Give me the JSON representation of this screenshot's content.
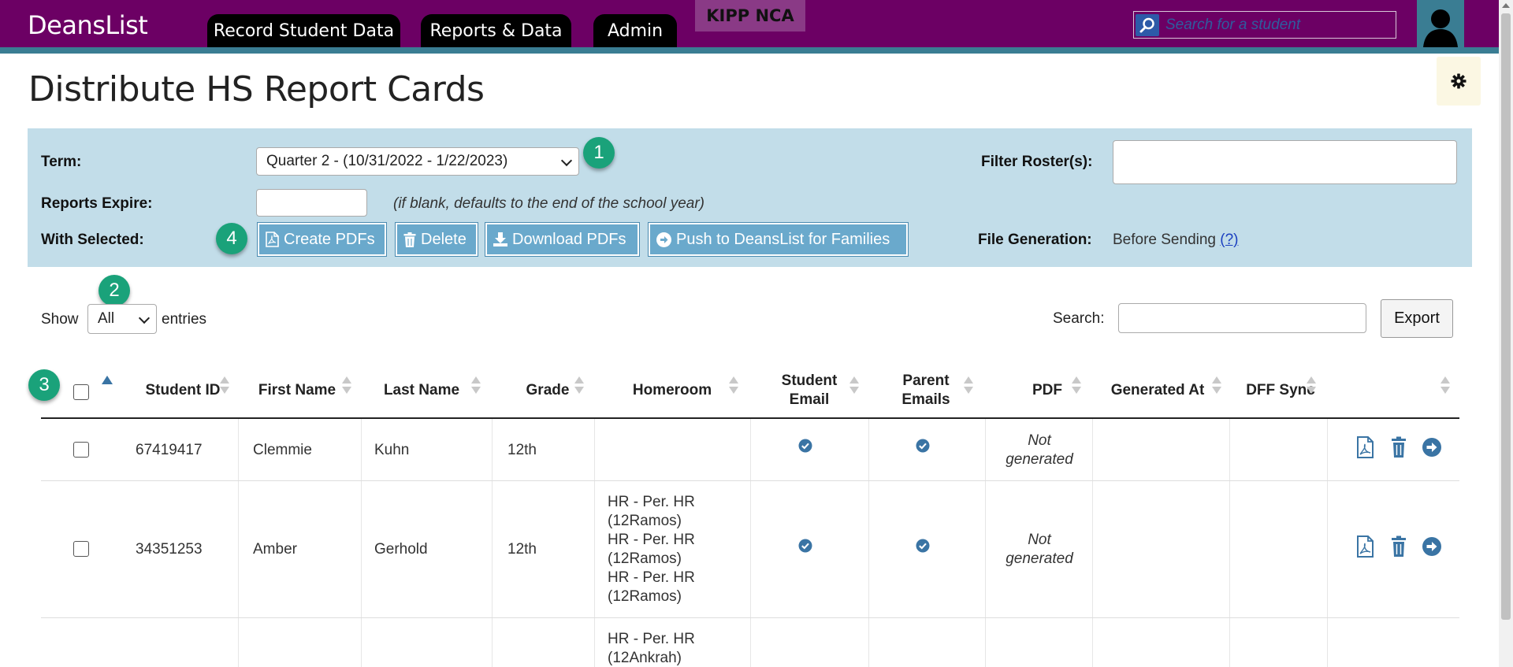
{
  "topbar": {
    "brand": "DeansList",
    "tabs": [
      "Record Student Data",
      "Reports & Data",
      "Admin"
    ],
    "school": "KIPP NCA",
    "search_placeholder": "Search for a student"
  },
  "page": {
    "title": "Distribute HS Report Cards"
  },
  "filters": {
    "term_label": "Term:",
    "term_value": "Quarter 2 - (10/31/2022 - 1/22/2023)",
    "expire_label": "Reports Expire:",
    "expire_hint": "(if blank, defaults to the end of the school year)",
    "with_selected_label": "With Selected:",
    "actions": [
      "Create PDFs",
      "Delete",
      "Download PDFs",
      "Push to DeansList for Families"
    ],
    "filter_roster_label": "Filter Roster(s):",
    "file_generation_label": "File Generation:",
    "file_generation_value": "Before Sending",
    "file_generation_help": "(?)"
  },
  "steps": [
    "1",
    "2",
    "3",
    "4"
  ],
  "entries": {
    "show_label": "Show",
    "value": "All",
    "entries_label": "entries",
    "search_label": "Search:",
    "export_label": "Export"
  },
  "table": {
    "headers": [
      "Student ID",
      "First Name",
      "Last Name",
      "Grade",
      "Homeroom",
      "Student Email",
      "Parent Emails",
      "PDF",
      "Generated At",
      "DFF Sync"
    ],
    "rows": [
      {
        "student_id": "67419417",
        "first_name": "Clemmie",
        "last_name": "Kuhn",
        "grade": "12th",
        "homeroom": [],
        "pdf": "Not generated"
      },
      {
        "student_id": "34351253",
        "first_name": "Amber",
        "last_name": "Gerhold",
        "grade": "12th",
        "homeroom": [
          "HR - Per. HR",
          "(12Ramos)",
          "HR - Per. HR",
          "(12Ramos)",
          "HR - Per. HR",
          "(12Ramos)"
        ],
        "pdf": "Not generated"
      },
      {
        "student_id": "",
        "first_name": "",
        "last_name": "",
        "grade": "",
        "homeroom": [
          "HR - Per. HR",
          "(12Ankrah)"
        ],
        "pdf": ""
      }
    ]
  },
  "colors": {
    "topbar": "#6c0064",
    "accent": "#3a7d93",
    "panel": "#c2dde9",
    "action_button": "#6aa9cc",
    "step_badge": "#1aa27a",
    "icon_blue": "#3a74a4"
  }
}
